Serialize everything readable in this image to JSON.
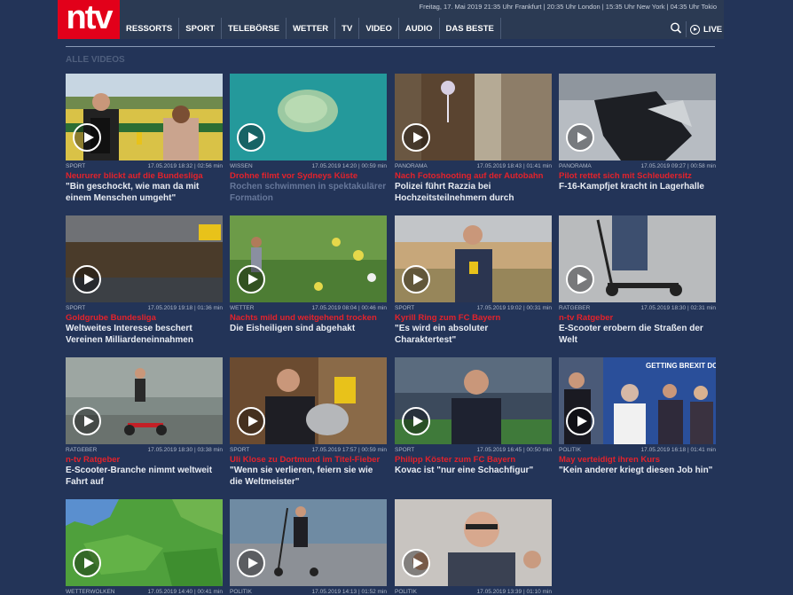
{
  "header": {
    "logo": "ntv",
    "timebar": "Freitag, 17. Mai 2019 21:35 Uhr Frankfurt | 20:35 Uhr London | 15:35 Uhr New York | 04:35 Uhr Tokio",
    "nav": [
      "RESSORTS",
      "SPORT",
      "TELEBÖRSE",
      "WETTER",
      "TV",
      "VIDEO",
      "AUDIO",
      "DAS BESTE"
    ],
    "live": "LIVE"
  },
  "section_title": "ALLE VIDEOS",
  "videos": [
    {
      "cat": "SPORT",
      "meta": "17.05.2019 18:32 | 02:56 min",
      "kicker": "Neururer blickt auf die Bundesliga",
      "headline": "\"Bin geschockt, wie man da mit einem Menschen umgeht\""
    },
    {
      "cat": "WISSEN",
      "meta": "17.05.2019 14:20 | 00:59 min",
      "kicker": "Drohne filmt vor Sydneys Küste",
      "headline": "Rochen schwimmen in spektakulärer Formation"
    },
    {
      "cat": "PANORAMA",
      "meta": "17.05.2019 18:43 | 01:41 min",
      "kicker": "Nach Fotoshooting auf der Autobahn",
      "headline": "Polizei führt Razzia bei Hochzeitsteilnehmern durch"
    },
    {
      "cat": "PANORAMA",
      "meta": "17.05.2019 09:27 | 00:58 min",
      "kicker": "Pilot rettet sich mit Schleudersitz",
      "headline": "F-16-Kampfjet kracht in Lagerhalle"
    },
    {
      "cat": "SPORT",
      "meta": "17.05.2019 19:18 | 01:36 min",
      "kicker": "Goldgrube Bundesliga",
      "headline": "Weltweites Interesse beschert Vereinen Milliardeneinnahmen"
    },
    {
      "cat": "WETTER",
      "meta": "17.05.2019 08:04 | 00:46 min",
      "kicker": "Nachts mild und weitgehend trocken",
      "headline": "Die Eisheiligen sind abgehakt"
    },
    {
      "cat": "SPORT",
      "meta": "17.05.2019 19:02 | 00:31 min",
      "kicker": "Kyrill Ring zum FC Bayern",
      "headline": "\"Es wird ein absoluter Charaktertest\""
    },
    {
      "cat": "RATGEBER",
      "meta": "17.05.2019 18:30 | 02:31 min",
      "kicker": "n-tv Ratgeber",
      "headline": "E-Scooter erobern die Straßen der Welt"
    },
    {
      "cat": "RATGEBER",
      "meta": "17.05.2019 18:30 | 03:38 min",
      "kicker": "n-tv Ratgeber",
      "headline": "E-Scooter-Branche nimmt weltweit Fahrt auf"
    },
    {
      "cat": "SPORT",
      "meta": "17.05.2019 17:57 | 00:59 min",
      "kicker": "Uli Klose zu Dortmund im Titel-Fieber",
      "headline": "\"Wenn sie verlieren, feiern sie wie die Weltmeister\""
    },
    {
      "cat": "SPORT",
      "meta": "17.05.2019 16:45 | 00:50 min",
      "kicker": "Philipp Köster zum FC Bayern",
      "headline": "Kovac ist \"nur eine Schachfigur\""
    },
    {
      "cat": "POLITIK",
      "meta": "17.05.2019 16:18 | 01:41 min",
      "kicker": "May verteidigt ihren Kurs",
      "headline": "\"Kein anderer kriegt diesen Job hin\""
    },
    {
      "cat": "WETTERWOLKEN",
      "meta": "17.05.2019 14:40 | 00:41 min",
      "kicker": "",
      "headline": ""
    },
    {
      "cat": "POLITIK",
      "meta": "17.05.2019 14:13 | 01:52 min",
      "kicker": "",
      "headline": ""
    },
    {
      "cat": "POLITIK",
      "meta": "17.05.2019 13:39 | 01:10 min",
      "kicker": "",
      "headline": ""
    }
  ],
  "thumb_texts": {
    "brexit_sign": "GETTING BREXIT DONE IN THE NATIONAL INT"
  }
}
